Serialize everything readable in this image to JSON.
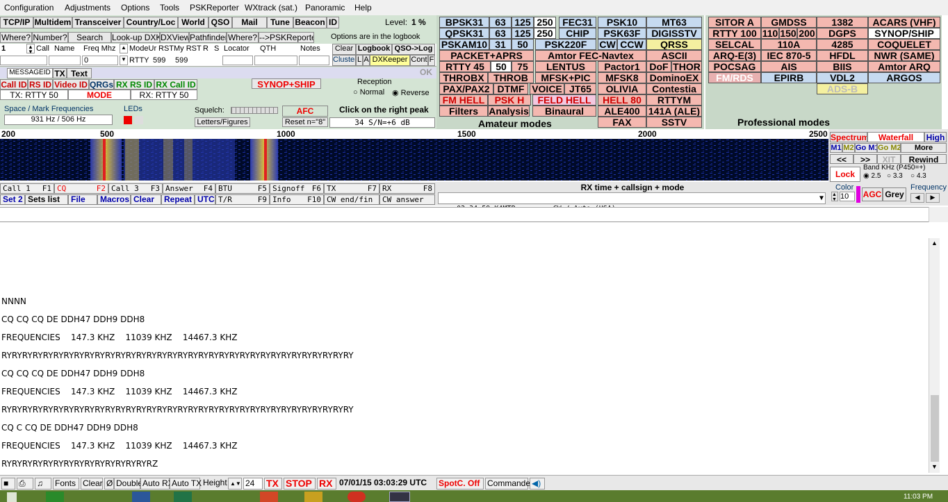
{
  "menu": [
    "Configuration",
    "Adjustments",
    "Options",
    "Tools",
    "PSKReporter",
    "WXtrack (sat.)",
    "Panoramic",
    "Help"
  ],
  "toolbar1": [
    "TCP/IP",
    "Multidem",
    "Transceiver",
    "Country/Loc",
    "World",
    "QSO",
    "Mail",
    "Tune",
    "Beacon",
    "ID"
  ],
  "level_label": "Level:",
  "level_value": "1 %",
  "toolbar2": [
    "Where?",
    "Number?",
    "Search",
    "Look-up DXK",
    "DXView",
    "Pathfinder",
    "Where?",
    "-->PSKReporter"
  ],
  "logbook_note": "Options are in the logbook",
  "log_headers": [
    "Call",
    "Name",
    "Freq Mhz",
    "ModeUr",
    "RST",
    "My RST",
    "R",
    "S",
    "Locator",
    "QTH",
    "Notes"
  ],
  "log_row": {
    "num": "1",
    "freq": "0",
    "mode": "RTTY",
    "rst": "599",
    "myrst": "599"
  },
  "log_buttons": [
    "Clear",
    "Logbook",
    "QSO->Log",
    "Cluster",
    "L",
    "A",
    "DXKeeper",
    "Cont",
    "F"
  ],
  "msg_tabs": [
    "MESSAGEID",
    "TX",
    "Text"
  ],
  "ok_label": "OK",
  "id_buttons": [
    "Call ID",
    "RS ID",
    "Video ID",
    "QRGs",
    "RX RS ID",
    "RX Call ID"
  ],
  "tx_mode": "TX: RTTY 50",
  "mode_btn": "MODE",
  "rx_mode": "RX: RTTY 50",
  "synop_btn": "SYNOP+SHIP",
  "reception": {
    "title": "Reception",
    "normal": "Normal",
    "reverse": "Reverse"
  },
  "space_mark": {
    "title": "Space / Mark Frequencies",
    "value": "931 Hz / 506 Hz"
  },
  "leds_label": "LEDs",
  "squelch_label": "Squelch:",
  "afc_label": "AFC",
  "click_peak": "Click on the right peak",
  "letters_btn": "Letters/Figures",
  "reset_btn": "Reset n=\"8\"",
  "sn_value": "34  S/N=+6 dB",
  "amateur_modes": [
    [
      "BPSK31",
      "63",
      "125",
      "250",
      "FEC31",
      "PSK10",
      "MT63"
    ],
    [
      "QPSK31",
      "63",
      "125",
      "250",
      "CHIP",
      "PSK63F",
      "DIGISSTV"
    ],
    [
      "PSKAM10",
      "31",
      "50",
      "PSK220F",
      "CW",
      "CCW",
      "QRSS"
    ],
    [
      "PACKET+APRS",
      "Amtor FEC-Navtex",
      "ASCII"
    ],
    [
      "RTTY 45",
      "50",
      "75",
      "LENTUS",
      "Pactor1",
      "DoF",
      "THOR"
    ],
    [
      "THROBX",
      "THROB",
      "MFSK+PIC",
      "MFSK8",
      "DominoEX"
    ],
    [
      "PAX/PAX2",
      "DTMF",
      "VOICE",
      "JT65",
      "OLIVIA",
      "Contestia"
    ],
    [
      "FM HELL",
      "PSK H",
      "FELD HELL",
      "HELL 80",
      "RTTYM"
    ],
    [
      "Filters",
      "Analysis",
      "Binaural",
      "ALE400",
      "141A (ALE)"
    ]
  ],
  "amateur_title": "Amateur modes",
  "amateur_extra": [
    "FAX",
    "SSTV"
  ],
  "pro_modes": [
    [
      "SITOR A",
      "GMDSS",
      "1382",
      "ACARS (VHF)"
    ],
    [
      "RTTY 100",
      "110",
      "150",
      "200",
      "DGPS",
      "SYNOP/SHIP"
    ],
    [
      "SELCAL",
      "110A",
      "4285",
      "COQUELET"
    ],
    [
      "ARQ-E(3)",
      "IEC 870-5",
      "HFDL",
      "NWR (SAME)"
    ],
    [
      "POCSAG",
      "AIS",
      "BIIS",
      "Amtor ARQ"
    ],
    [
      "FM/RDS",
      "EPIRB",
      "VDL2",
      "ARGOS"
    ],
    [
      "ADS-B"
    ]
  ],
  "pro_title": "Professional modes",
  "ruler_ticks": [
    "200",
    "500",
    "1000",
    "1500",
    "2000",
    "2500"
  ],
  "right_ctl": {
    "tabs": [
      "Spectrum",
      "Waterfall",
      "High"
    ],
    "mem": [
      "M1",
      "M2",
      "Go M1",
      "Go M2",
      "More"
    ],
    "nav": [
      "<<",
      ">>",
      "XIT",
      "Rewind"
    ],
    "lock": "Lock",
    "band_label": "Band KHz (P450=+)",
    "band_opts": [
      "2.5",
      "3.3",
      "4.3"
    ],
    "color_label": "Color",
    "color_value": "10",
    "agc": "AGC",
    "grey": "Grey",
    "freq_label": "Frequency"
  },
  "fkeys": [
    [
      "Call 1",
      "F1"
    ],
    [
      "CQ",
      "F2"
    ],
    [
      "Call 3",
      "F3"
    ],
    [
      "Answer",
      "F4"
    ],
    [
      "BTU",
      "F5"
    ],
    [
      "Signoff",
      "F6"
    ],
    [
      "TX",
      "F7"
    ],
    [
      "RX",
      "F8"
    ]
  ],
  "fkeys2": [
    "Set 2",
    "Sets list",
    "File",
    "Macros",
    "Clear",
    "Repeat",
    "UTC"
  ],
  "fkeys3": [
    [
      "T/R",
      "F9"
    ],
    [
      "Info",
      "F10"
    ],
    [
      "CW end/fin",
      ""
    ],
    [
      "CW answer",
      ""
    ]
  ],
  "rxlog_title": "RX time + callsign + mode",
  "rxlog_entry": "02:34:59 K4MTP         CW / Auto (USA)",
  "rx_lines": [
    "",
    "",
    "",
    "NNNN",
    "CQ CQ CQ DE DDH47 DDH9 DDH8",
    "FREQUENCIES    147.3 KHZ    11039 KHZ    14467.3 KHZ",
    "RYRYRYRYRYRYRYRYRYRYRYRYRYRYRYRYRYRYRYRYRYRYRYRYRYRYRYRYRYRYRYRYRYRY",
    "CQ CQ CQ DE DDH47 DDH9 DDH8",
    "FREQUENCIES    147.3 KHZ    11039 KHZ    14467.3 KHZ",
    "RYRYRYRYRYRYRYRYRYRYRYRYRYRYRYRYRYRYRYRYRYRYRYRYRYRYRYRYRYRYRYRYRYRY",
    "CQ C CQ DE DDH47 DDH9 DDH8",
    "FREQUENCIES    147.3 KHZ    11039 KHZ    14467.3 KHZ",
    "RYRYRYRYRYRYRYRYRYRYRYRYRYRYRZ"
  ],
  "status": {
    "fonts": "Fonts",
    "clear": "Clear",
    "zero": "Ø",
    "double": "Double",
    "autorx": "Auto RX",
    "autotx": "Auto TX",
    "height": "Height",
    "height_val": "24",
    "tx": "TX",
    "stop": "STOP",
    "rx": "RX",
    "datetime": "07/01/15 03:03:29 UTC",
    "spotc": "SpotC. Off",
    "commander": "Commander"
  },
  "clock": "11:03 PM",
  "colors": {
    "panel": "#d4e4d4",
    "blue_btn": "#c6daf0",
    "pink_btn": "#f4b8b0",
    "red": "#e00000",
    "waterfall_bg": "#000814",
    "taskbar": "#5a7c2e"
  }
}
